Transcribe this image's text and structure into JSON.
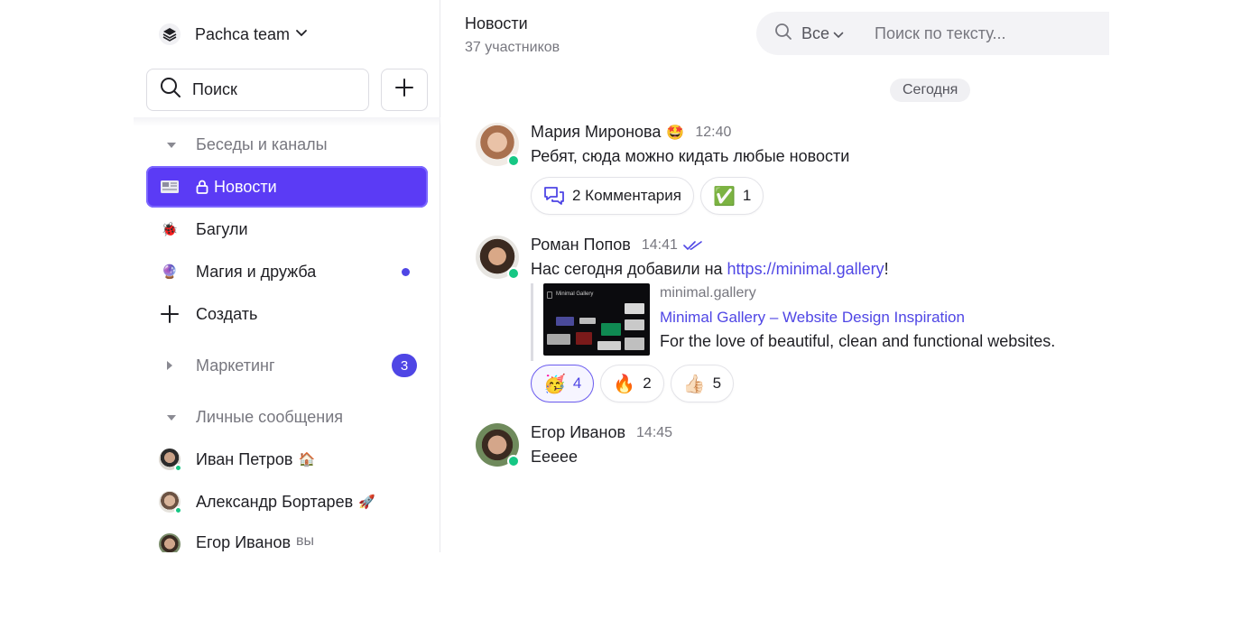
{
  "sidebar": {
    "team_name": "Pachca team",
    "search_label": "Поиск",
    "sections": {
      "chats_title": "Беседы и каналы",
      "marketing_title": "Маркетинг",
      "marketing_count": "3",
      "dm_title": "Личные сообщения"
    },
    "channels": [
      {
        "label": "Новости",
        "icon": "newspaper-icon",
        "active": true,
        "locked": true
      },
      {
        "label": "Багули",
        "icon": "ladybug-icon"
      },
      {
        "label": "Магия и дружба",
        "icon": "crystal-ball-icon",
        "unread": true
      }
    ],
    "create_label": "Создать",
    "dms": [
      {
        "name": "Иван Петров",
        "emoji": "🏠"
      },
      {
        "name": "Александр Бортарев",
        "emoji": "🚀"
      },
      {
        "name": "Егор Иванов",
        "suffix": "вы"
      }
    ]
  },
  "header": {
    "title": "Новости",
    "subtitle": "37 участников",
    "filter_label": "Все",
    "search_placeholder": "Поиск по тексту..."
  },
  "date_divider": "Сегодня",
  "messages": [
    {
      "author": "Мария Миронова",
      "author_emoji": "🤩",
      "time": "12:40",
      "text": "Ребят, сюда можно кидать любые новости",
      "comments_label": "2 Комментария",
      "reactions": [
        {
          "emoji": "✅",
          "count": "1"
        }
      ]
    },
    {
      "author": "Роман Попов",
      "time": "14:41",
      "text_before": "Нас сегодня добавили на ",
      "link": "https://minimal.gallery",
      "text_after": "!",
      "preview": {
        "thumb_title": "Minimal Gallery",
        "site": "minimal.gallery",
        "title": "Minimal Gallery – Website Design Inspiration",
        "description": "For the love of beautiful, clean and functional websites."
      },
      "reactions": [
        {
          "emoji": "🥳",
          "count": "4",
          "mine": true
        },
        {
          "emoji": "🔥",
          "count": "2"
        },
        {
          "emoji": "👍🏻",
          "count": "5"
        }
      ]
    },
    {
      "author": "Егор Иванов",
      "time": "14:45",
      "text": "Ееееe"
    }
  ],
  "colors": {
    "accent": "#5b3bf5",
    "link": "#4f46e5",
    "online": "#16c784"
  }
}
